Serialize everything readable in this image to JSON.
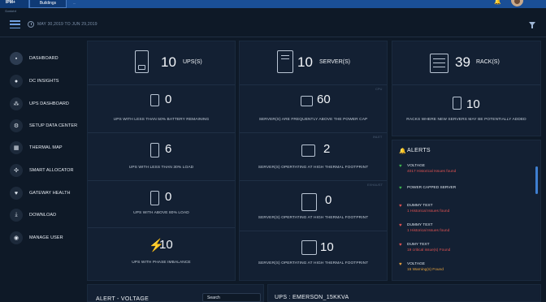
{
  "topbar": {
    "brand": "IPM+",
    "brand_sub": "Sunbird",
    "tab": "Buildings",
    "small_text": "..."
  },
  "subbar": {
    "date_range": "MAY 30,2019 TO JUN 29,2019"
  },
  "sidebar": {
    "items": [
      {
        "label": "DASHBOARD",
        "icon": "grid-icon",
        "glyph": "▪"
      },
      {
        "label": "DC INSIGHTS",
        "icon": "people-icon",
        "glyph": "●"
      },
      {
        "label": "UPS DASHBOARD",
        "icon": "hierarchy-icon",
        "glyph": "⁂"
      },
      {
        "label": "SETUP DATA CENTER",
        "icon": "gear-icon",
        "glyph": "⚙"
      },
      {
        "label": "THERMAL MAP",
        "icon": "map-icon",
        "glyph": "▦"
      },
      {
        "label": "SMART ALLOCATOR",
        "icon": "network-icon",
        "glyph": "✣"
      },
      {
        "label": "GATEWAY HEALTH",
        "icon": "heart-icon",
        "glyph": "♥"
      },
      {
        "label": "DOWNLOAD",
        "icon": "download-icon",
        "glyph": "⤓"
      },
      {
        "label": "MANAGE USER",
        "icon": "user-icon",
        "glyph": "◉"
      }
    ]
  },
  "ups_card": {
    "total": "10",
    "total_label": "UPS(S)",
    "metrics": [
      {
        "value": "0",
        "caption": "UPS WITH LESS THAN 50% BATTERY REMAINING"
      },
      {
        "value": "6",
        "caption": "UPS WITH LESS THAN 30% LOAD"
      },
      {
        "value": "0",
        "caption": "UPS WITH ABOVE 80% LOAD"
      },
      {
        "value": "10",
        "caption": "UPS WITH PHASE IMBALANCE"
      }
    ]
  },
  "server_card": {
    "total": "10",
    "total_label": "SERVER(S)",
    "metrics": [
      {
        "value": "60",
        "tag": "CPU",
        "caption": "SERVER(S) ARE FREQUENTLY ABOVE THE POWER CAP"
      },
      {
        "value": "2",
        "tag": "INLET",
        "caption": "SERVER(S) OPERTATING AT HIGH  THERMAL FOOTPRINT"
      },
      {
        "value": "0",
        "tag": "EXHAUST",
        "caption": "SERVER(S) OPERTATING AT HIGH  THERMAL FOOTPRINT"
      },
      {
        "value": "10",
        "tag": "",
        "caption": "SERVER(S) OPERTATING AT HIGH THERMAL FOOTPRINT"
      }
    ]
  },
  "rack_card": {
    "total": "39",
    "total_label": "RACK(S)",
    "metric_value": "10",
    "metric_caption": "RACKS WHERE NEW SERVERS MAY BE POTENTIALLY ADDED"
  },
  "alerts": {
    "title": "ALERTS",
    "items": [
      {
        "name": "VOLTAGE",
        "detail": "4017 Historical Issues found",
        "color": "#3fb950",
        "detail_color": "#e05252"
      },
      {
        "name": "POWER CAPPED SERVER",
        "detail": "",
        "color": "#3fb950",
        "detail_color": "#e05252"
      },
      {
        "name": "DUMMY TEXT",
        "detail": "1 Historical Issues found",
        "color": "#e05252",
        "detail_color": "#e05252"
      },
      {
        "name": "DUMMY TEXT",
        "detail": "1 Historical Issues found",
        "color": "#e05252",
        "detail_color": "#e05252"
      },
      {
        "name": "DUMY TEXT",
        "detail": "19 critical issue(s) Found",
        "color": "#e05252",
        "detail_color": "#e05252"
      },
      {
        "name": "VOLTAGE",
        "detail": "15 Warning(s) Found",
        "color": "#e8a33d",
        "detail_color": "#e8a33d"
      }
    ]
  },
  "bottom": {
    "alert_title": "ALERT - VOLTAGE",
    "search_placeholder": "Search",
    "ups_title": "UPS : EMERSON_15KKVA"
  }
}
